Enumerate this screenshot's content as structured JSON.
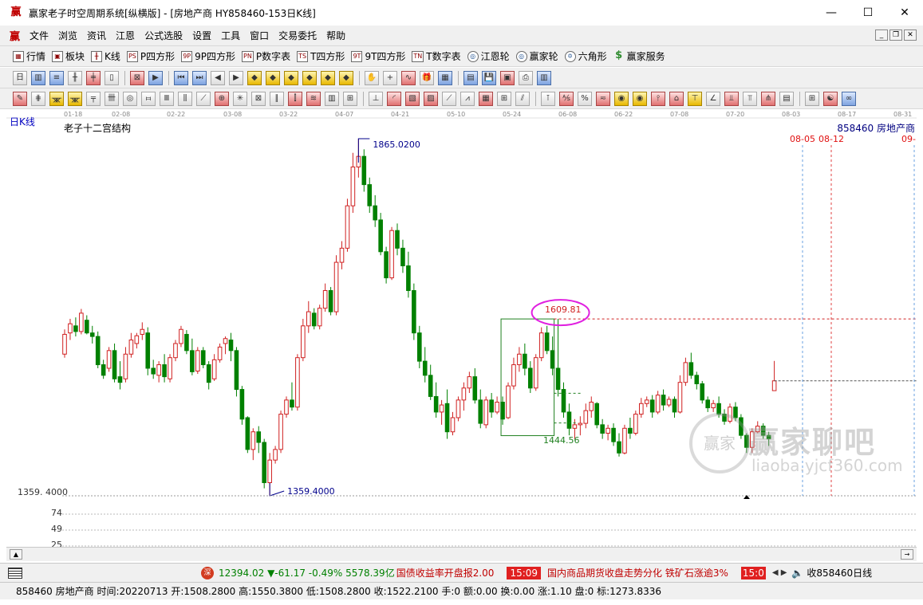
{
  "window": {
    "title": "赢家老子时空周期系统[纵横版] - [房地产商  HY858460-153日K线]",
    "minimize_glyph": "—",
    "maximize_glyph": "☐",
    "close_glyph": "✕"
  },
  "menu": {
    "items": [
      "文件",
      "浏览",
      "资讯",
      "江恩",
      "公式选股",
      "设置",
      "工具",
      "窗口",
      "交易委托",
      "帮助"
    ]
  },
  "toolbar1": {
    "items": [
      {
        "icon": "▦",
        "label": "行情"
      },
      {
        "icon": "▣",
        "label": "板块"
      },
      {
        "icon": "╫",
        "label": "K线"
      },
      {
        "icon": "PS",
        "label": "P四方形"
      },
      {
        "icon": "9P",
        "label": "9P四方形"
      },
      {
        "icon": "PN",
        "label": "P数字表"
      },
      {
        "icon": "TS",
        "label": "T四方形"
      },
      {
        "icon": "9T",
        "label": "9T四方形"
      },
      {
        "icon": "TN",
        "label": "T数字表"
      },
      {
        "icon": "◎",
        "label": "江恩轮"
      },
      {
        "icon": "◎",
        "label": "赢家轮"
      },
      {
        "icon": "✡",
        "label": "六角形"
      },
      {
        "icon": "$",
        "label": "赢家服务"
      }
    ]
  },
  "chart": {
    "period_label": "日K线",
    "study_name": "老子十二宫结构",
    "code_label": "858460  房地产商",
    "high_label": "1865.0200",
    "low_label": "1359.4000",
    "axis_low_label": "1359. 4000",
    "box_high_label": "1609.81",
    "box_low_label": "1444.56",
    "future_dates": [
      "08-05",
      "08-12",
      "09-"
    ],
    "date_ticks": [
      "01-18",
      "02-08",
      "02-22",
      "03-08",
      "03-22",
      "04-07",
      "04-21",
      "05-10",
      "05-24",
      "06-08",
      "06-22",
      "07-08",
      "07-20",
      "08-03",
      "08-17",
      "08-31"
    ],
    "indicator_ticks": [
      "74",
      "49",
      "25"
    ],
    "watermark_main": "赢家聊吧",
    "watermark_url": "liaoba.yjcf360.com",
    "watermark_seal": "赢家"
  },
  "ticker": {
    "index_icon": "深",
    "index_text": "12394.02 ▼-61.17 -0.49% 5578.39亿",
    "news1": "国债收益率开盘报2.00",
    "time1": "15:09",
    "news2": "国内商品期货收盘走势分化 铁矿石涨逾3%",
    "time2": "15:0",
    "nav": "◀ ▶",
    "speaker": "🔈",
    "right_text": "收858460日线"
  },
  "status": {
    "text": "858460 房地产商 时间:20220713 开:1508.2800 高:1550.3800 低:1508.2800 收:1522.2100 手:0 额:0.00 换:0.00 涨:1.10 盘:0 标:1273.8336"
  },
  "colors": {
    "up": "#d02020",
    "down": "#008000",
    "accent_label": "#d02020",
    "ellipse": "#e020e0",
    "box": "#208020",
    "extreme_label": "#00008b"
  },
  "chart_data": {
    "type": "candlestick",
    "y_range": [
      1359.4,
      1865.02
    ],
    "high": 1865.02,
    "low": 1359.4,
    "resistance": 1609.81,
    "support": 1444.56,
    "last_close": 1522.21,
    "ohlc": [
      [
        1560,
        1595,
        1555,
        1588
      ],
      [
        1590,
        1610,
        1580,
        1603
      ],
      [
        1600,
        1612,
        1585,
        1592
      ],
      [
        1592,
        1624,
        1588,
        1618
      ],
      [
        1608,
        1615,
        1588,
        1590
      ],
      [
        1590,
        1600,
        1575,
        1585
      ],
      [
        1585,
        1592,
        1540,
        1545
      ],
      [
        1545,
        1552,
        1525,
        1530
      ],
      [
        1540,
        1570,
        1535,
        1565
      ],
      [
        1565,
        1575,
        1520,
        1525
      ],
      [
        1528,
        1550,
        1510,
        1520
      ],
      [
        1525,
        1570,
        1520,
        1560
      ],
      [
        1560,
        1590,
        1555,
        1580
      ],
      [
        1575,
        1590,
        1568,
        1586
      ],
      [
        1588,
        1605,
        1580,
        1595
      ],
      [
        1590,
        1598,
        1530,
        1540
      ],
      [
        1540,
        1552,
        1525,
        1532
      ],
      [
        1530,
        1550,
        1520,
        1545
      ],
      [
        1545,
        1560,
        1520,
        1528
      ],
      [
        1525,
        1560,
        1520,
        1555
      ],
      [
        1555,
        1580,
        1550,
        1575
      ],
      [
        1575,
        1600,
        1570,
        1595
      ],
      [
        1588,
        1594,
        1560,
        1565
      ],
      [
        1565,
        1582,
        1530,
        1535
      ],
      [
        1536,
        1570,
        1532,
        1565
      ],
      [
        1565,
        1570,
        1540,
        1545
      ],
      [
        1545,
        1550,
        1510,
        1520
      ],
      [
        1525,
        1560,
        1522,
        1552
      ],
      [
        1552,
        1575,
        1548,
        1570
      ],
      [
        1575,
        1585,
        1560,
        1582
      ],
      [
        1580,
        1590,
        1550,
        1565
      ],
      [
        1565,
        1570,
        1500,
        1510
      ],
      [
        1510,
        1515,
        1460,
        1468
      ],
      [
        1470,
        1472,
        1420,
        1425
      ],
      [
        1425,
        1455,
        1410,
        1450
      ],
      [
        1450,
        1458,
        1420,
        1435
      ],
      [
        1435,
        1440,
        1370,
        1378
      ],
      [
        1378,
        1420,
        1359.4,
        1410
      ],
      [
        1410,
        1430,
        1405,
        1425
      ],
      [
        1425,
        1480,
        1420,
        1475
      ],
      [
        1475,
        1500,
        1470,
        1495
      ],
      [
        1495,
        1520,
        1480,
        1485
      ],
      [
        1485,
        1560,
        1480,
        1555
      ],
      [
        1555,
        1610,
        1550,
        1600
      ],
      [
        1600,
        1635,
        1590,
        1620
      ],
      [
        1618,
        1625,
        1595,
        1600
      ],
      [
        1600,
        1630,
        1595,
        1625
      ],
      [
        1625,
        1660,
        1620,
        1650
      ],
      [
        1650,
        1655,
        1615,
        1620
      ],
      [
        1620,
        1700,
        1615,
        1690
      ],
      [
        1690,
        1720,
        1680,
        1710
      ],
      [
        1710,
        1780,
        1705,
        1770
      ],
      [
        1770,
        1845,
        1760,
        1825
      ],
      [
        1825,
        1865.02,
        1810,
        1840
      ],
      [
        1840,
        1850,
        1790,
        1800
      ],
      [
        1800,
        1810,
        1760,
        1770
      ],
      [
        1770,
        1785,
        1740,
        1750
      ],
      [
        1750,
        1760,
        1700,
        1705
      ],
      [
        1705,
        1712,
        1660,
        1668
      ],
      [
        1668,
        1740,
        1665,
        1735
      ],
      [
        1735,
        1745,
        1700,
        1710
      ],
      [
        1710,
        1722,
        1675,
        1685
      ],
      [
        1685,
        1705,
        1640,
        1650
      ],
      [
        1650,
        1660,
        1580,
        1590
      ],
      [
        1590,
        1600,
        1540,
        1550
      ],
      [
        1550,
        1570,
        1520,
        1530
      ],
      [
        1530,
        1545,
        1495,
        1500
      ],
      [
        1500,
        1520,
        1470,
        1478
      ],
      [
        1478,
        1495,
        1460,
        1488
      ],
      [
        1490,
        1510,
        1440,
        1450
      ],
      [
        1450,
        1478,
        1445,
        1470
      ],
      [
        1470,
        1500,
        1465,
        1495
      ],
      [
        1495,
        1520,
        1480,
        1512
      ],
      [
        1512,
        1535,
        1505,
        1528
      ],
      [
        1528,
        1540,
        1490,
        1495
      ],
      [
        1495,
        1510,
        1455,
        1462
      ],
      [
        1460,
        1500,
        1455,
        1495
      ],
      [
        1495,
        1505,
        1470,
        1478
      ],
      [
        1478,
        1500,
        1475,
        1492
      ],
      [
        1492,
        1500,
        1460,
        1468
      ],
      [
        1470,
        1520,
        1468,
        1515
      ],
      [
        1515,
        1555,
        1510,
        1545
      ],
      [
        1545,
        1570,
        1535,
        1560
      ],
      [
        1560,
        1575,
        1530,
        1540
      ],
      [
        1540,
        1550,
        1505,
        1512
      ],
      [
        1512,
        1560,
        1508,
        1555
      ],
      [
        1555,
        1598,
        1550,
        1590
      ],
      [
        1590,
        1600,
        1560,
        1565
      ],
      [
        1565,
        1585,
        1530,
        1540
      ],
      [
        1540,
        1610,
        1500,
        1510
      ],
      [
        1510,
        1520,
        1470,
        1478
      ],
      [
        1478,
        1490,
        1445,
        1455
      ],
      [
        1455,
        1468,
        1440,
        1460
      ],
      [
        1460,
        1472,
        1445,
        1462
      ],
      [
        1462,
        1490,
        1455,
        1480
      ],
      [
        1480,
        1500,
        1470,
        1492
      ],
      [
        1490,
        1492,
        1455,
        1460
      ],
      [
        1460,
        1468,
        1440,
        1448
      ],
      [
        1448,
        1460,
        1438,
        1455
      ],
      [
        1455,
        1462,
        1430,
        1436
      ],
      [
        1436,
        1448,
        1415,
        1420
      ],
      [
        1420,
        1460,
        1418,
        1455
      ],
      [
        1455,
        1470,
        1440,
        1448
      ],
      [
        1448,
        1480,
        1445,
        1475
      ],
      [
        1475,
        1498,
        1470,
        1490
      ],
      [
        1490,
        1500,
        1485,
        1495
      ],
      [
        1495,
        1502,
        1470,
        1478
      ],
      [
        1478,
        1508,
        1475,
        1502
      ],
      [
        1502,
        1510,
        1480,
        1488
      ],
      [
        1488,
        1500,
        1485,
        1496
      ],
      [
        1496,
        1500,
        1470,
        1478
      ],
      [
        1478,
        1530,
        1476,
        1520
      ],
      [
        1520,
        1555,
        1515,
        1548
      ],
      [
        1548,
        1562,
        1525,
        1530
      ],
      [
        1530,
        1535,
        1510,
        1518
      ],
      [
        1518,
        1522,
        1490,
        1495
      ],
      [
        1495,
        1500,
        1478,
        1484
      ],
      [
        1484,
        1495,
        1478,
        1490
      ],
      [
        1490,
        1500,
        1470,
        1475
      ],
      [
        1475,
        1482,
        1460,
        1465
      ],
      [
        1465,
        1490,
        1462,
        1485
      ],
      [
        1485,
        1492,
        1465,
        1470
      ],
      [
        1470,
        1475,
        1440,
        1445
      ],
      [
        1445,
        1448,
        1420,
        1428
      ],
      [
        1428,
        1455,
        1420,
        1450
      ],
      [
        1450,
        1465,
        1448,
        1458
      ],
      [
        1458,
        1462,
        1440,
        1445
      ],
      [
        1445,
        1450,
        1430,
        1440
      ],
      [
        1508.28,
        1550.38,
        1508.28,
        1522.21
      ]
    ]
  }
}
